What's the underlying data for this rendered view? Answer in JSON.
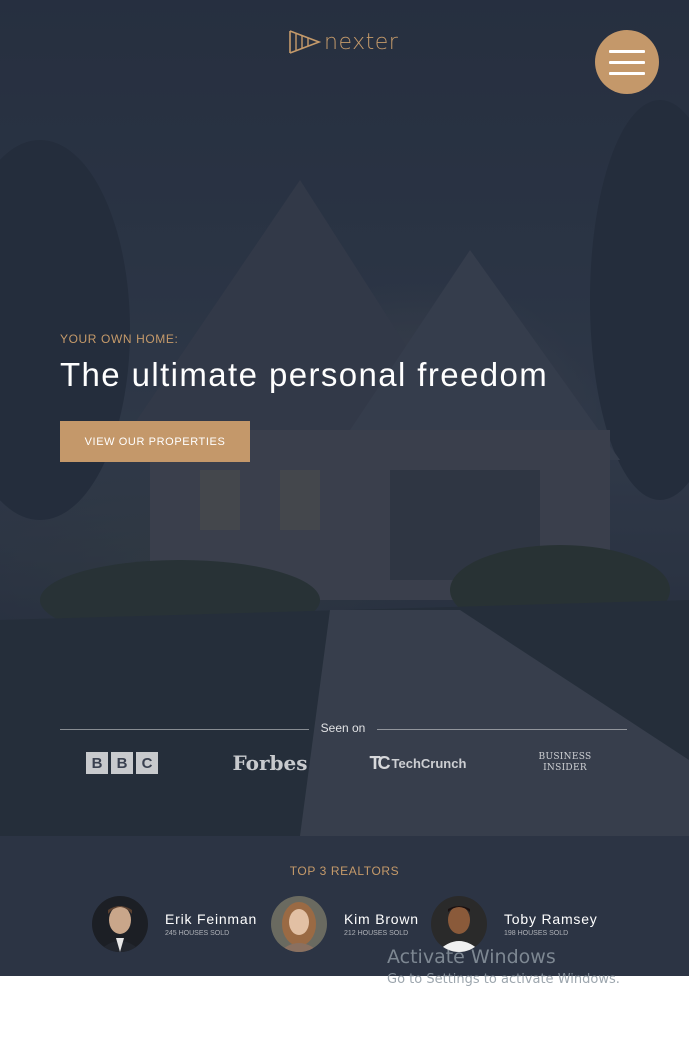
{
  "header": {
    "logo_text": "nexter",
    "logo_icon": "play-chevrons-logo",
    "menu_icon": "hamburger-menu-icon"
  },
  "hero": {
    "eyebrow": "YOUR OWN HOME:",
    "headline": "The ultimate personal freedom",
    "cta_label": "VIEW OUR PROPERTIES"
  },
  "seen_on": {
    "label": "Seen on",
    "logos": [
      {
        "name": "BBC",
        "letters": [
          "B",
          "B",
          "C"
        ]
      },
      {
        "name": "Forbes",
        "text": "Forbes"
      },
      {
        "name": "TechCrunch",
        "mark": "TC",
        "text": "TechCrunch"
      },
      {
        "name": "Business Insider",
        "line1": "BUSINESS",
        "line2": "INSIDER"
      }
    ]
  },
  "realtors": {
    "title": "TOP 3 REALTORS",
    "items": [
      {
        "name": "Erik Feinman",
        "sold": "245 HOUSES SOLD"
      },
      {
        "name": "Kim Brown",
        "sold": "212 HOUSES SOLD"
      },
      {
        "name": "Toby Ramsey",
        "sold": "198 HOUSES SOLD"
      }
    ]
  },
  "watermark": {
    "title": "Activate Windows",
    "subtitle": "Go to Settings to activate Windows."
  },
  "colors": {
    "accent": "#c4986a",
    "hero_bg": "#323c4c",
    "realtors_bg": "#2c3444",
    "white": "#ffffff"
  }
}
